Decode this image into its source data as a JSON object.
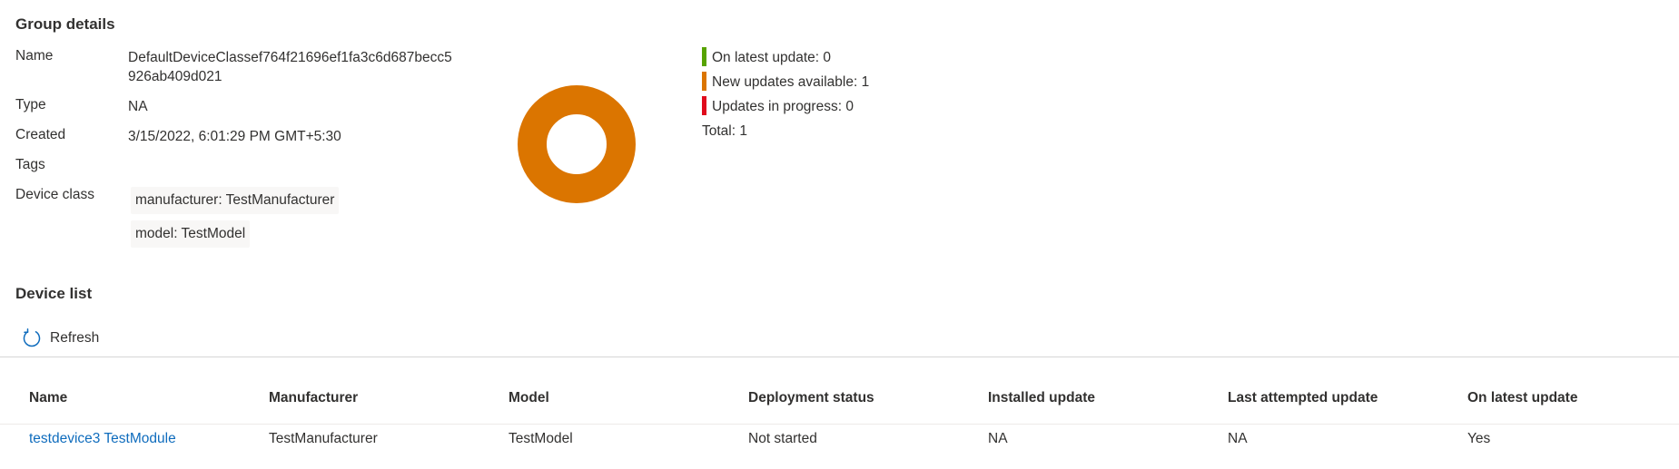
{
  "group_details": {
    "title": "Group details",
    "fields": {
      "name_label": "Name",
      "name_value_line1": "DefaultDeviceClassef764f21696ef1fa3c6d687becc5",
      "name_value_line2": "926ab409d021",
      "type_label": "Type",
      "type_value": "NA",
      "created_label": "Created",
      "created_value": "3/15/2022, 6:01:29 PM GMT+5:30",
      "tags_label": "Tags",
      "device_class_label": "Device class",
      "device_class_tags": [
        "manufacturer: TestManufacturer",
        "model: TestModel"
      ]
    }
  },
  "status_summary": {
    "legend": [
      {
        "label": "On latest update: 0",
        "color": "#57a300",
        "value": 0
      },
      {
        "label": "New updates available: 1",
        "color": "#db7500",
        "value": 1
      },
      {
        "label": "Updates in progress: 0",
        "color": "#e00b1c",
        "value": 0
      }
    ],
    "total_label": "Total: 1",
    "donut_color": "#db7500"
  },
  "device_list": {
    "title": "Device list",
    "refresh_label": "Refresh",
    "columns": [
      "Name",
      "Manufacturer",
      "Model",
      "Deployment status",
      "Installed update",
      "Last attempted update",
      "On latest update"
    ],
    "rows": [
      [
        "testdevice3 TestModule",
        "TestManufacturer",
        "TestModel",
        "Not started",
        "NA",
        "NA",
        "Yes"
      ]
    ],
    "accent_color": "#0f6cbd"
  }
}
